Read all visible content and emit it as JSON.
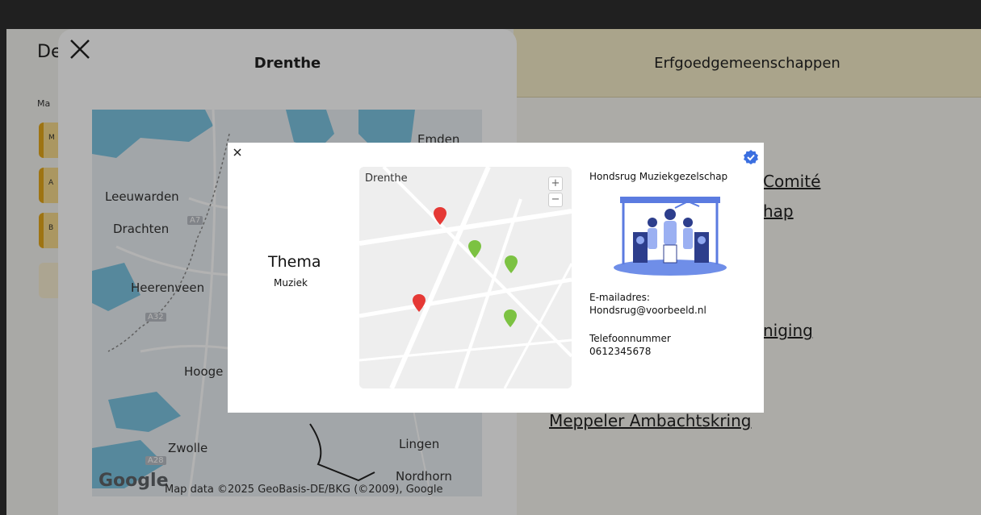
{
  "background": {
    "title_partial": "De",
    "subtitle_partial": "Ma",
    "chip_letters": [
      "M",
      "A",
      "B"
    ]
  },
  "right_panel": {
    "header": "Erfgoedgemeenschappen",
    "links_visible": [
      "Comité",
      "hap",
      "niging",
      "Meppeler Ambachtskring"
    ]
  },
  "drenthe_panel": {
    "title": "Drenthe",
    "map": {
      "places": [
        "Emden",
        "Leeuwarden",
        "Drachten",
        "Heerenveen",
        "Hooge",
        "Zwolle",
        "Lingen",
        "Nordhorn"
      ],
      "road_badges": [
        "A7",
        "A32",
        "A28"
      ],
      "logo": "Google",
      "attribution": "Map data ©2025 GeoBasis-DE/BKG (©2009), Google"
    }
  },
  "modal": {
    "close_icon": "close-icon",
    "theme_label": "Thema",
    "theme_value": "Muziek",
    "map": {
      "label": "Drenthe",
      "zoom_in": "+",
      "zoom_out": "−",
      "pins": [
        {
          "color": "#e53935"
        },
        {
          "color": "#7cc242"
        },
        {
          "color": "#7cc242"
        },
        {
          "color": "#e53935"
        },
        {
          "color": "#7cc242"
        }
      ]
    },
    "org_name": "Hondsrug Muziekgezelschap",
    "verified_icon": "verified-badge-icon",
    "email_label": "E-mailadres:",
    "email_value": "Hondsrug@voorbeeld.nl",
    "phone_label": "Telefoonnummer",
    "phone_value": "0612345678",
    "accent_color": "#3b6fe0"
  }
}
